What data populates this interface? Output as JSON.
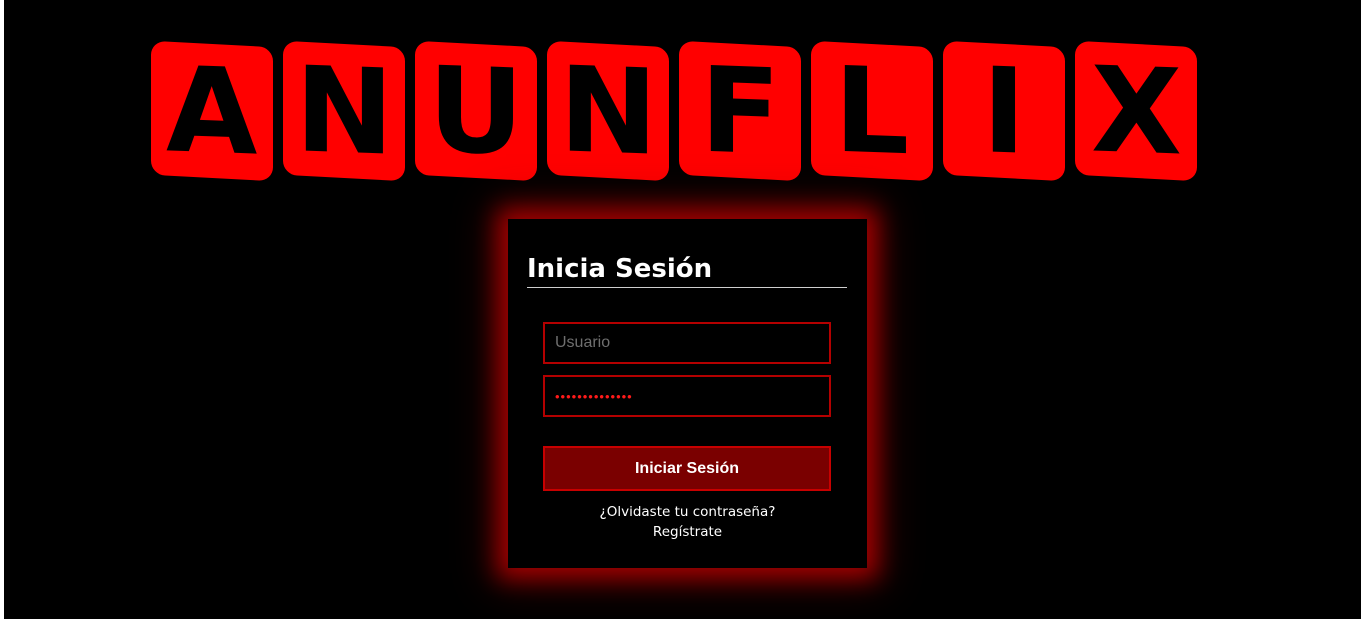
{
  "brand": {
    "letters": [
      "A",
      "N",
      "U",
      "N",
      "F",
      "L",
      "I",
      "X"
    ],
    "tile_color": "#ff0000",
    "letter_color": "#000000"
  },
  "login": {
    "title": "Inicia Sesión",
    "username_placeholder": "Usuario",
    "username_value": "",
    "password_value": "••••••••••••••",
    "submit_label": "Iniciar Sesión",
    "forgot_link": "¿Olvidaste tu contraseña?",
    "register_link": "Regístrate"
  },
  "colors": {
    "background": "#000000",
    "accent": "#ff0000",
    "button": "#7a0000",
    "glow": "#c80000"
  }
}
